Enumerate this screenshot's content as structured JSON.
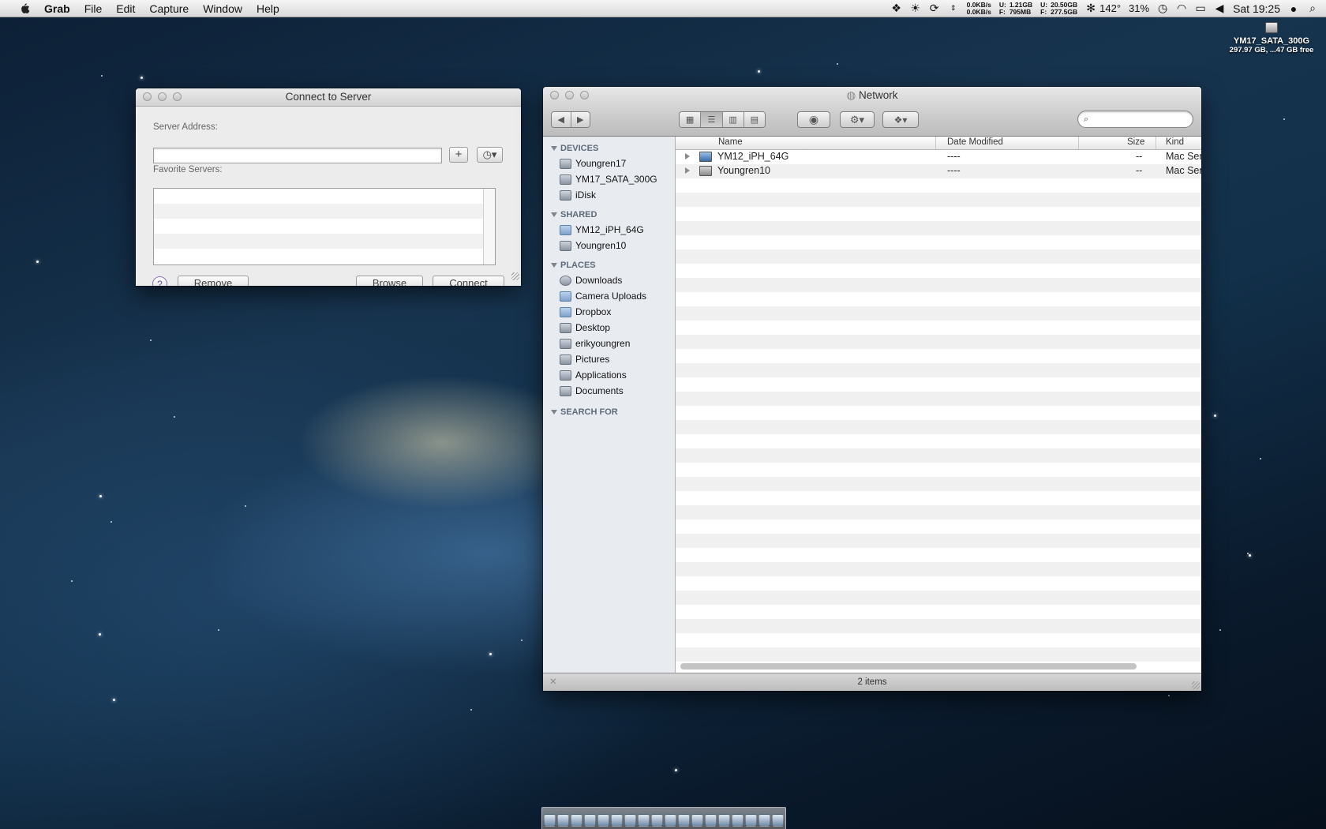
{
  "menubar": {
    "app_name": "Grab",
    "menus": [
      "File",
      "Edit",
      "Capture",
      "Window",
      "Help"
    ],
    "net_up": "0.0KB/s",
    "net_down": "0.0KB/s",
    "mem_u_label": "U:",
    "mem_u_value": "1.21GB",
    "mem_f_label": "F:",
    "mem_f_value": "795MB",
    "disk_u_label": "U:",
    "disk_u_value": "20.50GB",
    "disk_f_label": "F:",
    "disk_f_value": "277.5GB",
    "temperature": "142°",
    "battery": "31%",
    "clock": "Sat 19:25"
  },
  "desktop_drive": {
    "name": "YM17_SATA_300G",
    "details": "297.97 GB, ...47 GB free"
  },
  "connect_window": {
    "title": "Connect to Server",
    "server_address_label": "Server Address:",
    "server_address_value": "",
    "favorite_servers_label": "Favorite Servers:",
    "add_label": "+",
    "help_label": "?",
    "remove_label": "Remove",
    "browse_label": "Browse",
    "connect_label": "Connect"
  },
  "finder": {
    "title": "Network",
    "sidebar": {
      "devices_header": "DEVICES",
      "devices": [
        "Youngren17",
        "YM17_SATA_300G",
        "iDisk"
      ],
      "shared_header": "SHARED",
      "shared": [
        "YM12_iPH_64G",
        "Youngren10"
      ],
      "places_header": "PLACES",
      "places": [
        "Downloads",
        "Camera Uploads",
        "Dropbox",
        "Desktop",
        "erikyoungren",
        "Pictures",
        "Applications",
        "Documents"
      ],
      "search_header": "SEARCH FOR"
    },
    "columns": {
      "name": "Name",
      "date_modified": "Date Modified",
      "size": "Size",
      "kind": "Kind"
    },
    "rows": [
      {
        "name": "YM12_iPH_64G",
        "date": "----",
        "size": "--",
        "kind": "Mac Server"
      },
      {
        "name": "Youngren10",
        "date": "----",
        "size": "--",
        "kind": "Mac Server"
      }
    ],
    "status": "2 items"
  }
}
